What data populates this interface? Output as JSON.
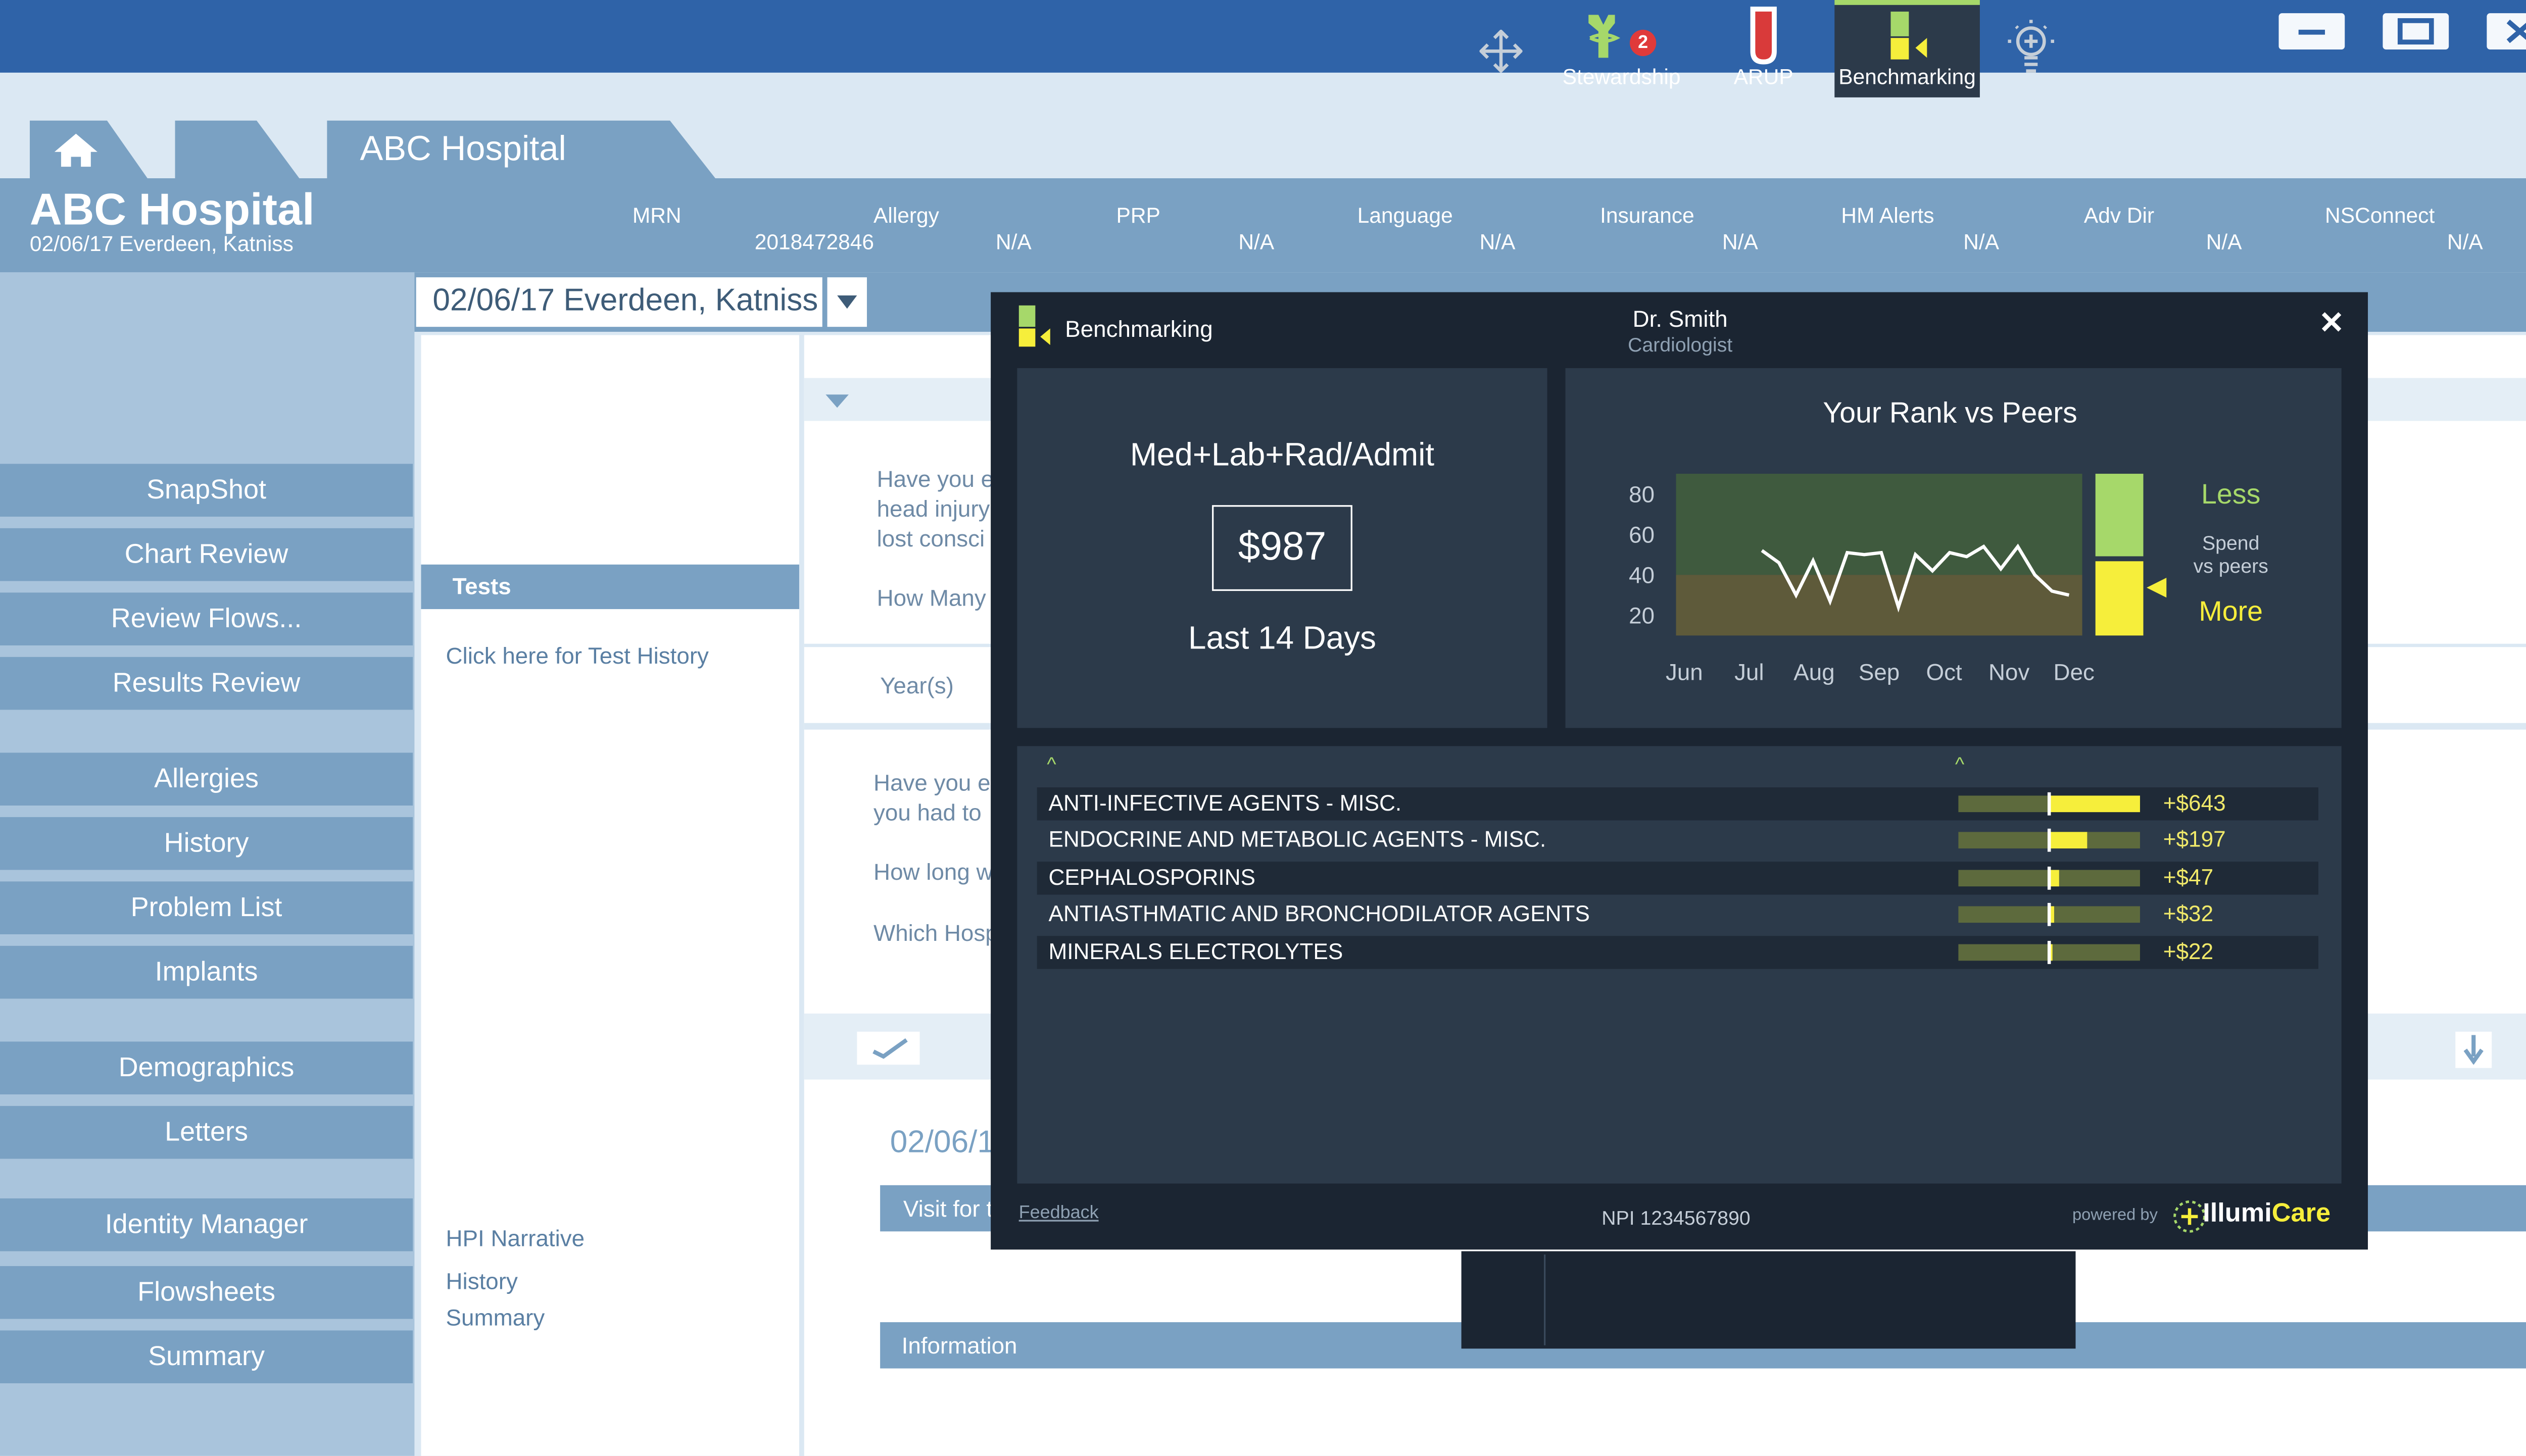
{
  "window": {
    "tab_title": "ABC Hospital"
  },
  "header": {
    "hospital": "ABC Hospital",
    "date_patient": "02/06/17  Everdeen, Katniss",
    "fields": [
      {
        "label": "MRN",
        "value": "2018472846"
      },
      {
        "label": "Allergy",
        "value": "N/A"
      },
      {
        "label": "PRP",
        "value": "N/A"
      },
      {
        "label": "Language",
        "value": "N/A"
      },
      {
        "label": "Insurance",
        "value": "N/A"
      },
      {
        "label": "HM Alerts",
        "value": "N/A"
      },
      {
        "label": "Adv Dir",
        "value": "N/A"
      },
      {
        "label": "NSConnect",
        "value": "N/A"
      }
    ]
  },
  "patient_selector": "02/06/17  Everdeen, Katniss",
  "nav": {
    "items": [
      "SnapShot",
      "Chart Review",
      "Review Flows...",
      "Results Review",
      "Allergies",
      "History",
      "Problem List",
      "Implants",
      "Demographics",
      "Letters",
      "Identity Manager",
      "Flowsheets",
      "Summary"
    ]
  },
  "tests_panel": {
    "title": "Tests",
    "history_link": "Click here for Test History",
    "links": [
      "HPI Narrative",
      "History",
      "Summary"
    ]
  },
  "form": {
    "q1": "Have you e",
    "q2": "head injury",
    "q3": "lost consci",
    "q4": "How Many",
    "years": "Year(s)",
    "q5": "Have you e",
    "q6": "you had to",
    "q7": "How long w",
    "q8": "Which Hosp",
    "date": "02/06/1",
    "visit": "Visit for t",
    "information": "Information"
  },
  "overlay": {
    "title": "Benchmarking",
    "doctor": "Dr. Smith",
    "specialty": "Cardiologist",
    "metric_label": "Med+Lab+Rad/Admit",
    "metric_value": "$987",
    "period": "Last 14 Days",
    "rank_title": "Your Rank vs Peers",
    "less": "Less",
    "spend": "Spend",
    "vs_peers": "vs peers",
    "more": "More",
    "caret": "^",
    "feedback": "Feedback",
    "npi": "NPI 1234567890",
    "powered_by": "powered by",
    "brand_a": "Illumi",
    "brand_b": "Care"
  },
  "chart_data": {
    "type": "line",
    "title": "Your Rank vs Peers",
    "categories": [
      "Jun",
      "Jul",
      "Aug",
      "Sep",
      "Oct",
      "Nov",
      "Dec"
    ],
    "yticks": [
      20,
      40,
      60,
      80
    ],
    "ylim": [
      10,
      90
    ],
    "values": [
      52,
      46,
      30,
      47,
      27,
      51,
      50,
      51,
      24,
      50,
      42,
      51,
      49,
      54,
      43,
      54,
      40,
      32,
      30
    ],
    "band_split": 40
  },
  "drugs": [
    {
      "name": "ANTI-INFECTIVE AGENTS - MISC.",
      "value": "+$643",
      "fraction": 1.0
    },
    {
      "name": "ENDOCRINE AND METABOLIC AGENTS - MISC.",
      "value": "+$197",
      "fraction": 0.42
    },
    {
      "name": "CEPHALOSPORINS",
      "value": "+$47",
      "fraction": 0.1
    },
    {
      "name": "ANTIASTHMATIC AND BRONCHODILATOR AGENTS",
      "value": "+$32",
      "fraction": 0.06
    },
    {
      "name": "MINERALS ELECTROLYTES",
      "value": "+$22",
      "fraction": 0.04
    }
  ],
  "dock": {
    "stewardship": "Stewardship",
    "badge": "2",
    "arup": "ARUP",
    "benchmarking": "Benchmarking"
  },
  "colors": {
    "accent_yellow": "#f6ee3b",
    "accent_green": "#a6d86a",
    "nav_blue": "#7aa1c3",
    "title_blue": "#2f63a8"
  }
}
